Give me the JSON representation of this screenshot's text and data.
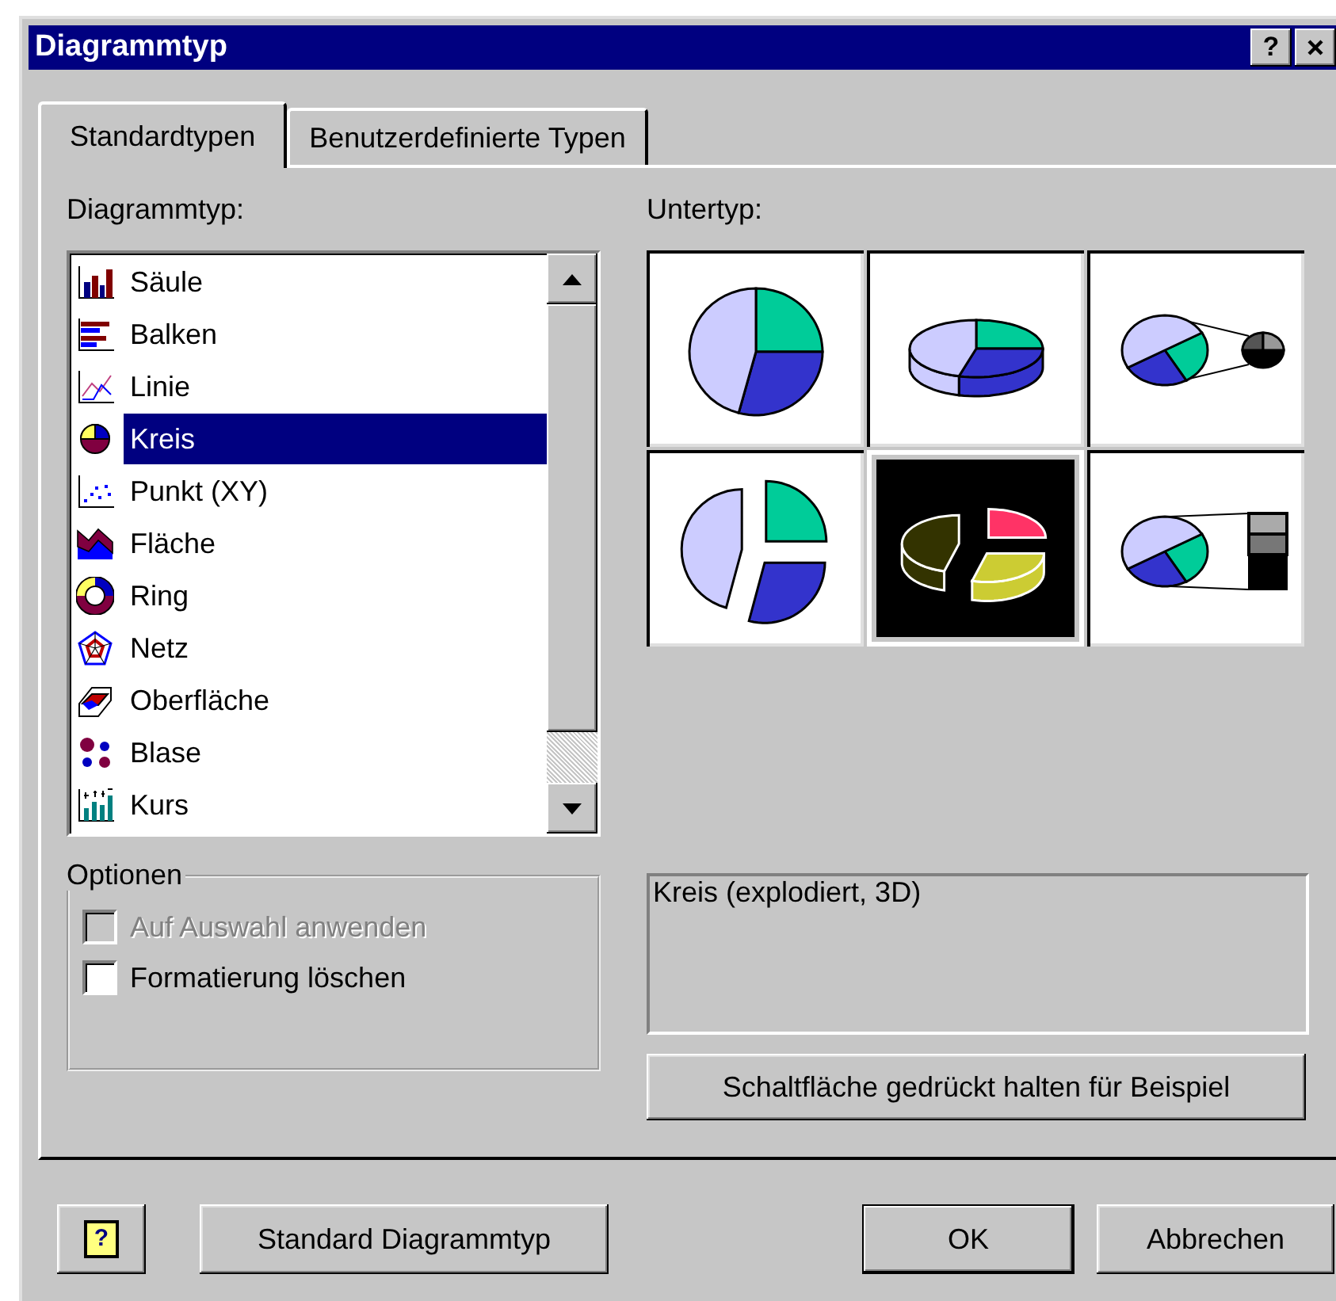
{
  "window": {
    "title": "Diagrammtyp",
    "help": "?"
  },
  "tabs": [
    {
      "label": "Standardtypen",
      "selected": true
    },
    {
      "label": "Benutzerdefinierte Typen",
      "selected": false
    }
  ],
  "chart_types": {
    "label": "Diagrammtyp:",
    "items": [
      {
        "kind": "column",
        "label": "Säule",
        "selected": false
      },
      {
        "kind": "bar",
        "label": "Balken",
        "selected": false
      },
      {
        "kind": "line",
        "label": "Linie",
        "selected": false
      },
      {
        "kind": "pie",
        "label": "Kreis",
        "selected": true
      },
      {
        "kind": "scatter",
        "label": "Punkt (XY)",
        "selected": false
      },
      {
        "kind": "area",
        "label": "Fläche",
        "selected": false
      },
      {
        "kind": "doughnut",
        "label": "Ring",
        "selected": false
      },
      {
        "kind": "radar",
        "label": "Netz",
        "selected": false
      },
      {
        "kind": "surface",
        "label": "Oberfläche",
        "selected": false
      },
      {
        "kind": "bubble",
        "label": "Blase",
        "selected": false
      },
      {
        "kind": "stock",
        "label": "Kurs",
        "selected": false
      }
    ]
  },
  "subtypes": {
    "label": "Untertyp:",
    "items": [
      {
        "kind": "pie",
        "selected": false
      },
      {
        "kind": "pie-3d",
        "selected": false
      },
      {
        "kind": "pie-of-pie",
        "selected": false
      },
      {
        "kind": "exploded",
        "selected": false
      },
      {
        "kind": "exploded-3d",
        "selected": true
      },
      {
        "kind": "bar-of-pie",
        "selected": false
      }
    ]
  },
  "options": {
    "title": "Optionen",
    "checkboxes": [
      {
        "label": "Auf Auswahl anwenden",
        "checked": false,
        "disabled": true
      },
      {
        "label": "Formatierung löschen",
        "checked": false,
        "disabled": false
      }
    ]
  },
  "description": "Kreis (explodiert, 3D)",
  "preview_button": "Schaltfläche gedrückt halten für Beispiel",
  "footer": {
    "help": "?",
    "buttons": [
      {
        "label": "Standard Diagrammtyp",
        "default": false
      },
      {
        "label": "OK",
        "default": true
      },
      {
        "label": "Abbrechen",
        "default": false
      }
    ]
  }
}
